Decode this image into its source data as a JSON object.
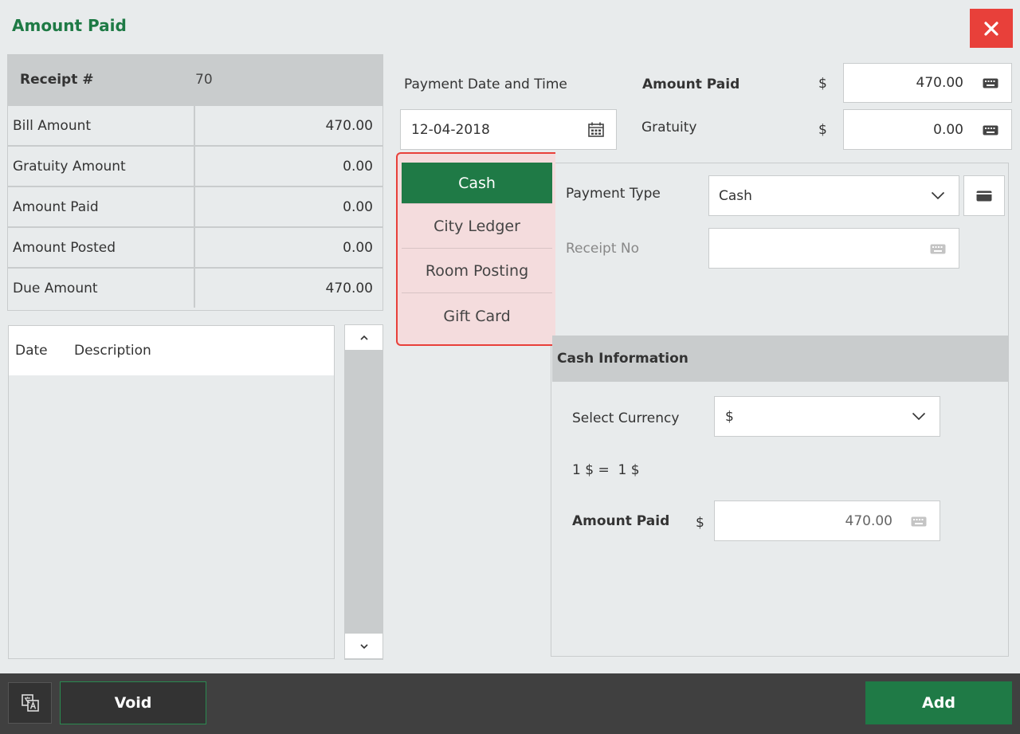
{
  "dialog": {
    "title": "Amount Paid"
  },
  "summary": {
    "receipt_label": "Receipt #",
    "receipt_value": "70",
    "rows": [
      {
        "label": "Bill Amount",
        "value": "470.00"
      },
      {
        "label": "Gratuity Amount",
        "value": "0.00"
      },
      {
        "label": "Amount Paid",
        "value": "0.00"
      },
      {
        "label": "Amount Posted",
        "value": "0.00"
      },
      {
        "label": "Due Amount",
        "value": "470.00"
      }
    ]
  },
  "history": {
    "col_date": "Date",
    "col_description": "Description"
  },
  "payment": {
    "date_label": "Payment Date and Time",
    "date_value": "12-04-2018",
    "amount_paid_label": "Amount Paid",
    "amount_currency": "$",
    "amount_paid_value": "470.00",
    "gratuity_label": "Gratuity",
    "gratuity_currency": "$",
    "gratuity_value": "0.00"
  },
  "tabs": [
    "Cash",
    "City Ledger",
    "Room Posting",
    "Gift Card"
  ],
  "detail": {
    "payment_type_label": "Payment Type",
    "payment_type_value": "Cash",
    "receipt_no_label": "Receipt No",
    "receipt_no_value": ""
  },
  "cash_info": {
    "heading": "Cash Information",
    "currency_label": "Select Currency",
    "currency_value": "$",
    "rate_text": "1 $ =  1 $",
    "amount_label": "Amount Paid",
    "amount_currency": "$",
    "amount_value": "470.00"
  },
  "footer": {
    "void_label": "Void",
    "add_label": "Add"
  },
  "colors": {
    "brand_green": "#1f7a46",
    "close_red": "#e8403a"
  }
}
